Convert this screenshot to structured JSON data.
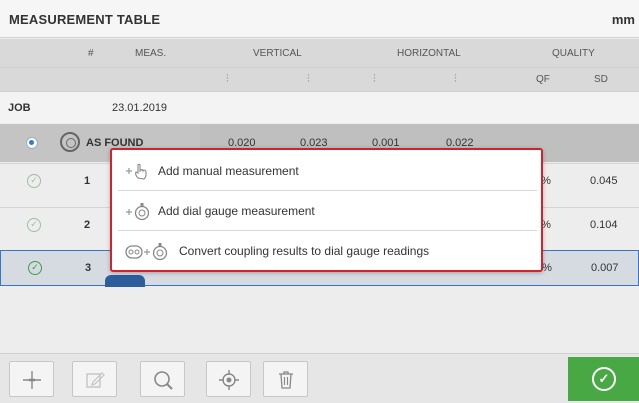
{
  "window": {
    "title": "MEASUREMENT TABLE",
    "unit": "mm"
  },
  "columns": {
    "hash": "#",
    "meas": "MEAS.",
    "vertical": "VERTICAL",
    "horizontal": "HORIZONTAL",
    "quality": "QUALITY",
    "qf": "QF",
    "sd": "SD"
  },
  "job": {
    "label": "JOB",
    "date": "23.01.2019"
  },
  "as_found": {
    "label": "AS FOUND",
    "values": [
      "0.020",
      "0.023",
      "0.001",
      "0.022"
    ]
  },
  "rows": [
    {
      "num": "1",
      "qf": "8%",
      "sd": "0.045"
    },
    {
      "num": "2",
      "qf": "4%",
      "sd": "0.104"
    },
    {
      "num": "3",
      "qf": "3%",
      "sd": "0.007"
    }
  ],
  "menu": {
    "items": [
      {
        "label": "Add manual measurement",
        "icon": "hand-pointer-icon"
      },
      {
        "label": "Add dial gauge measurement",
        "icon": "dial-gauge-icon"
      },
      {
        "label": "Convert coupling results to dial gauge readings",
        "icon": "coupling-to-gauge-icon"
      }
    ]
  },
  "toolbar": {
    "buttons": [
      "add-measurement-icon",
      "edit-icon",
      "search-icon",
      "target-icon",
      "delete-icon"
    ],
    "ok_icon": "check-circle-icon"
  },
  "colors": {
    "popup_border": "#d0232c",
    "ok_button": "#48a844",
    "selected_border": "#3a74c4"
  }
}
